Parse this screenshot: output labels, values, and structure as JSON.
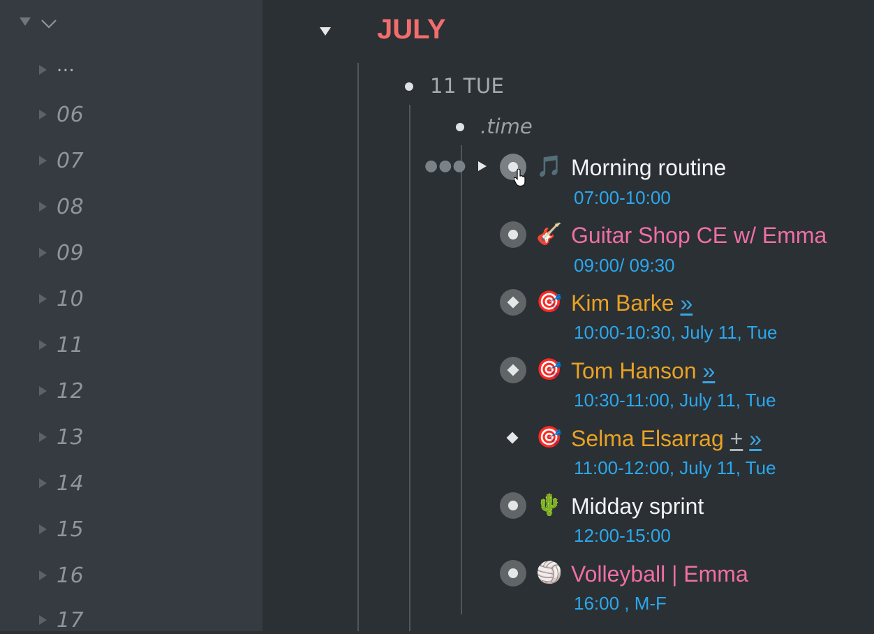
{
  "sidebar": {
    "items": [
      {
        "label": "..."
      },
      {
        "label": "06"
      },
      {
        "label": "07"
      },
      {
        "label": "08"
      },
      {
        "label": "09"
      },
      {
        "label": "10"
      },
      {
        "label": "11"
      },
      {
        "label": "12"
      },
      {
        "label": "13"
      },
      {
        "label": "14"
      },
      {
        "label": "15"
      },
      {
        "label": "16"
      },
      {
        "label": "17"
      }
    ]
  },
  "main": {
    "month": "JULY",
    "day": "11 TUE",
    "section": ".time",
    "tasks": [
      {
        "emoji": "🎵",
        "title": "Morning routine",
        "time": "07:00-10:00",
        "color": "#f1f3f4",
        "bullet": "circle"
      },
      {
        "emoji": "🎸",
        "title": "Guitar Shop CE w/ Emma",
        "time": "09:00/ 09:30",
        "color": "#ef6fa5",
        "bullet": "circle"
      },
      {
        "emoji": "🎯",
        "title": "Kim Barke",
        "link": "»",
        "time": "10:00-10:30, July 11, Tue",
        "color": "#e9a224",
        "bullet": "diamond"
      },
      {
        "emoji": "🎯",
        "title": "Tom Hanson",
        "link": "»",
        "time": "10:30-11:00, July 11, Tue",
        "color": "#e9a224",
        "bullet": "diamond"
      },
      {
        "emoji": "🎯",
        "title": "Selma Elsarrag",
        "plus": "+",
        "link": "»",
        "time": "11:00-12:00, July 11, Tue",
        "color": "#e9a224",
        "bullet": "diamond-plain"
      },
      {
        "emoji": "🌵",
        "title": "Midday sprint",
        "time": "12:00-15:00",
        "color": "#f1f3f4",
        "bullet": "circle"
      },
      {
        "emoji": "🏐",
        "title": "Volleyball | Emma",
        "time": "16:00 , M-F",
        "color": "#ef6fa5",
        "bullet": "circle"
      }
    ]
  }
}
